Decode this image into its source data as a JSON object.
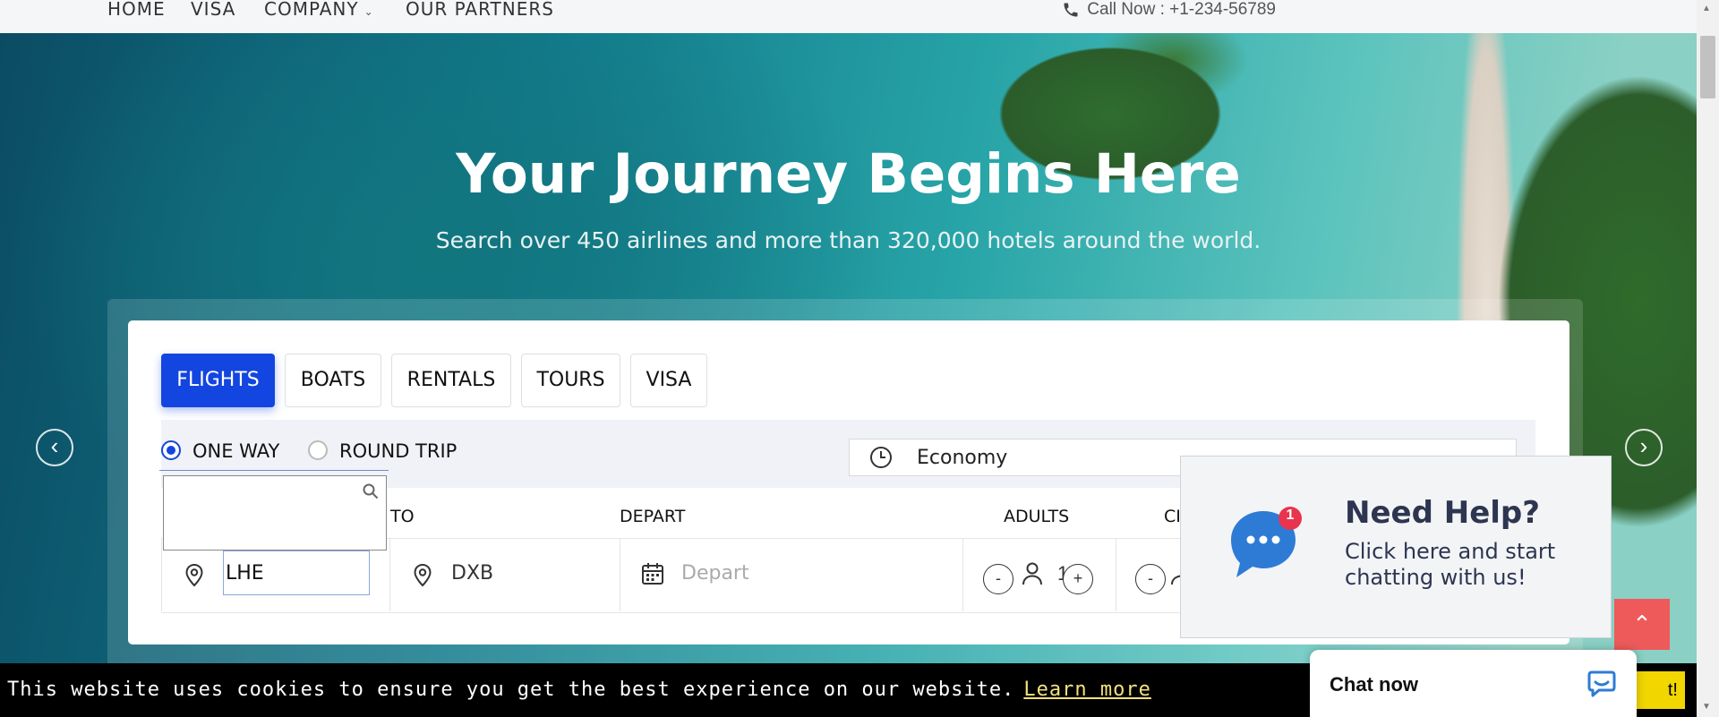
{
  "nav": {
    "items": [
      {
        "label": "HOME"
      },
      {
        "label": "VISA"
      },
      {
        "label": "COMPANY"
      },
      {
        "label": "OUR PARTNERS"
      }
    ],
    "call_now": "Call Now : +1-234-56789"
  },
  "hero": {
    "title": "Your Journey Begins Here",
    "subtitle": "Search over 450 airlines and more than 320,000 hotels around the world."
  },
  "search": {
    "tabs": [
      {
        "label": "FLIGHTS",
        "active": true
      },
      {
        "label": "BOATS"
      },
      {
        "label": "RENTALS"
      },
      {
        "label": "TOURS"
      },
      {
        "label": "VISA"
      }
    ],
    "trip_types": [
      {
        "label": "ONE WAY",
        "selected": true
      },
      {
        "label": "ROUND TRIP",
        "selected": false
      }
    ],
    "cabin_class": "Economy",
    "labels": {
      "to": "TO",
      "depart": "DEPART",
      "adults": "ADULTS",
      "children_partial": "CI"
    },
    "from_value": "LHE",
    "to_value": "DXB",
    "depart_placeholder": "Depart",
    "adults_value": "1",
    "minus": "-",
    "plus": "+"
  },
  "help_widget": {
    "title": "Need Help?",
    "text": "Click here and start chatting with us!",
    "badge": "1"
  },
  "chat": {
    "label": "Chat now"
  },
  "cookie": {
    "message": "This website uses cookies to ensure you get the best experience on our website.",
    "learn_more": "Learn more",
    "button_partial": "t!"
  },
  "colors": {
    "primary": "#1346e0",
    "top_button": "#ee5a5a",
    "cookie_bg": "#000000",
    "cookie_button": "#f1d600"
  }
}
